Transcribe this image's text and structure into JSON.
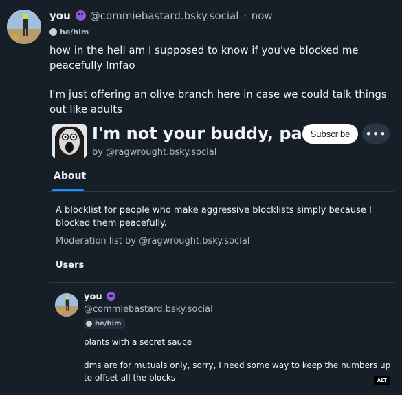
{
  "post": {
    "author_name": "you",
    "author_handle": "@commiebastard.bsky.social",
    "separator": "·",
    "time": "now",
    "pronouns": "he/him",
    "text": [
      "how in the hell am I supposed to know if you've blocked me peacefully lmfao",
      "I'm just offering an olive branch here in case we could talk things out like adults"
    ]
  },
  "embed": {
    "list_title": "I'm not your buddy, pal",
    "list_by": "by @ragwrought.bsky.social",
    "subscribe_label": "Subscribe",
    "more_label": "•••",
    "tabs": [
      {
        "label": "About",
        "active": true
      }
    ],
    "description": "A blocklist for people who make aggressive blocklists simply because I blocked them peacefully.",
    "moderation_label": "Moderation list by @ragwrought.bsky.social",
    "users_heading": "Users",
    "users": [
      {
        "name": "you",
        "handle": "@commiebastard.bsky.social",
        "pronouns": "he/him",
        "bio": [
          "plants with a secret sauce",
          "dms are for mutuals only, sorry, I need some way to keep the numbers up to offset all the blocks"
        ]
      }
    ]
  },
  "alt_badge": "ALT",
  "colors": {
    "background": "#161e27",
    "accent": "#1f8bff",
    "muted_text": "#aebbc9",
    "emoji_purple": "#8a5bd6"
  }
}
